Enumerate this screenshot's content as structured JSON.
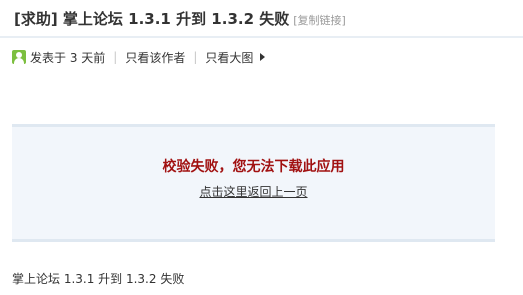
{
  "header": {
    "title": "[求助] 掌上论坛 1.3.1 升到 1.3.2 失败",
    "copy_link": "[复制链接]"
  },
  "meta": {
    "posted": "发表于 3 天前",
    "separator": "|",
    "only_author": "只看该作者",
    "only_images": "只看大图",
    "user_icon": "user-icon",
    "arrow_icon": "play-arrow-icon"
  },
  "notice": {
    "message": "校验失败，您无法下载此应用",
    "back_link": "点击这里返回上一页"
  },
  "footer": {
    "title": "掌上论坛 1.3.1 升到 1.3.2 失败"
  },
  "colors": {
    "error_text": "#a11111",
    "box_background": "#f2f6fb",
    "user_icon": "#7cbf3f"
  }
}
